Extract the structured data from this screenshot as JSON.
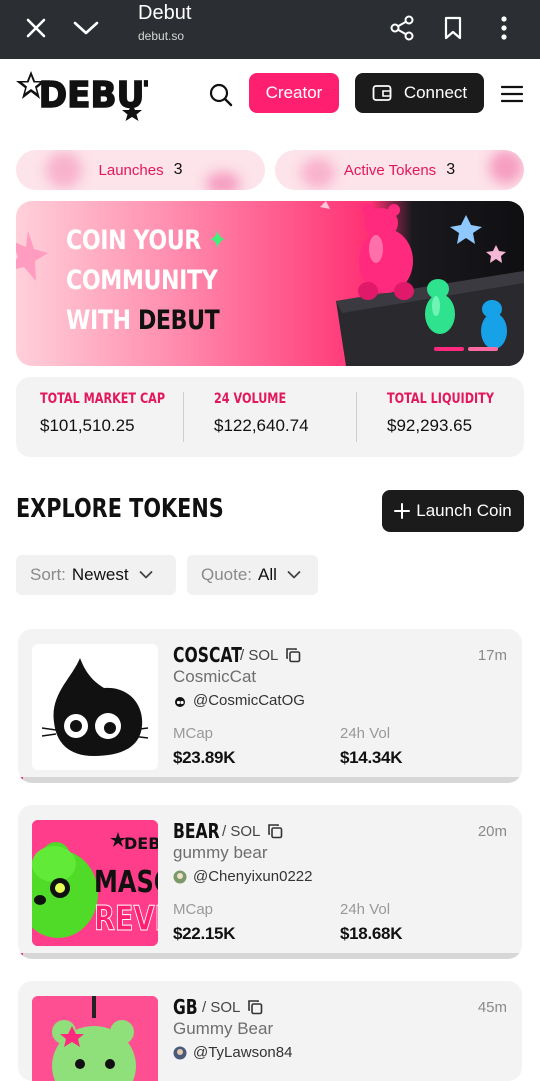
{
  "browser": {
    "title": "Debut",
    "url": "debut.so"
  },
  "header": {
    "creator_label": "Creator",
    "connect_label": "Connect"
  },
  "pills": [
    {
      "label": "Launches",
      "count": "3"
    },
    {
      "label": "Active Tokens",
      "count": "3"
    }
  ],
  "banner": {
    "line1": "COIN YOUR",
    "line2": "COMMUNITY",
    "line3_a": "WITH",
    "line3_b": "DEBUT"
  },
  "stats": [
    {
      "label": "TOTAL MARKET CAP",
      "value": "$101,510.25"
    },
    {
      "label": "24 VOLUME",
      "value": "$122,640.74"
    },
    {
      "label": "TOTAL LIQUIDITY",
      "value": "$92,293.65"
    }
  ],
  "explore": {
    "title": "EXPLORE TOKENS",
    "launch_label": "Launch Coin"
  },
  "filters": {
    "sort_label": "Sort:",
    "sort_value": "Newest",
    "quote_label": "Quote:",
    "quote_value": "All"
  },
  "tokens": [
    {
      "ticker": "COSCAT",
      "quote": "/ SOL",
      "time": "17m",
      "name": "CosmicCat",
      "handle": "@CosmicCatOG",
      "mcap_label": "MCap",
      "mcap": "$23.89K",
      "vol_label": "24h Vol",
      "vol": "$14.34K",
      "progress": 0.01
    },
    {
      "ticker": "BEAR",
      "quote": "/ SOL",
      "time": "20m",
      "name": "gummy bear",
      "handle": "@Chenyixun0222",
      "mcap_label": "MCap",
      "mcap": "$22.15K",
      "vol_label": "24h Vol",
      "vol": "$18.68K",
      "progress": 0.005
    },
    {
      "ticker": "GB",
      "quote": "/ SOL",
      "time": "45m",
      "name": "Gummy Bear",
      "handle": "@TyLawson84"
    }
  ],
  "thumb_texts": {
    "bear_line1": "MASC",
    "bear_line2": "REVI",
    "bear_logo": "DEBU"
  },
  "colors": {
    "accent": "#ff1f70",
    "label_pink": "#e3185c",
    "dark_button": "#1b1b1b",
    "browser_bar": "#2b2f33"
  }
}
